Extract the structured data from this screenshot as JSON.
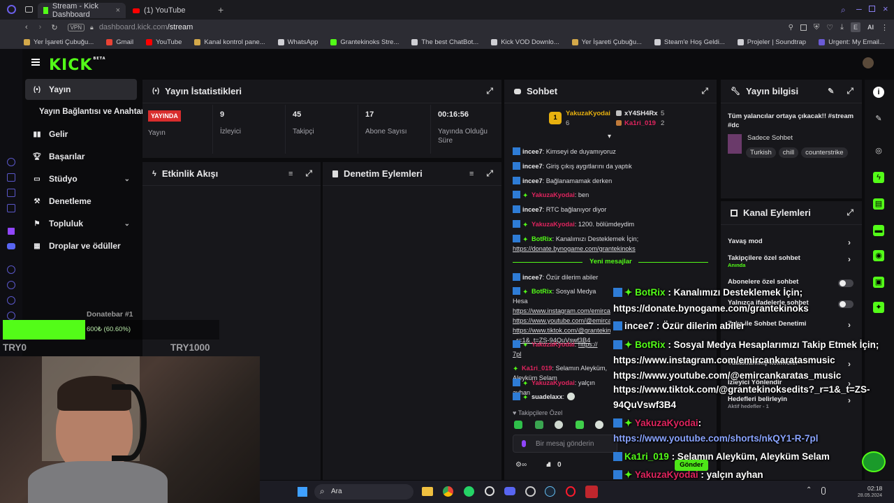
{
  "browser": {
    "tabs": [
      {
        "label": "Stream - Kick Dashboard",
        "active": true
      },
      {
        "label": "(1) YouTube",
        "active": false
      }
    ],
    "url": "dashboard.kick.com/stream",
    "url_host": "dashboard.kick.com",
    "url_path": "/stream",
    "vpn": "VPN",
    "profile_initial": "E",
    "ai_label": "AI",
    "bookmarks": [
      {
        "label": "Yer İşareti Çubuğu...",
        "color": "#d4a94a"
      },
      {
        "label": "Gmail",
        "color": "#ea4335"
      },
      {
        "label": "YouTube",
        "color": "#ff0000"
      },
      {
        "label": "Kanal kontrol pane...",
        "color": "#d4a94a"
      },
      {
        "label": "WhatsApp",
        "color": "#cfcfd4"
      },
      {
        "label": "Grantekinoks Stre...",
        "color": "#53fc18"
      },
      {
        "label": "The best ChatBot...",
        "color": "#cfcfd4"
      },
      {
        "label": "Kick VOD Downlo...",
        "color": "#cfcfd4"
      },
      {
        "label": "Yer İşareti Çubuğu...",
        "color": "#d4a94a"
      },
      {
        "label": "Steam'e Hoş Geldi...",
        "color": "#cfcfd4"
      },
      {
        "label": "Projeler | Soundtrap",
        "color": "#cfcfd4"
      },
      {
        "label": "Urgent: My Email...",
        "color": "#6b5bd6"
      }
    ]
  },
  "kick": {
    "logo": "KICK",
    "logo_badge": "BETA",
    "nav": [
      {
        "label": "Yayın",
        "icon": "broadcast-icon",
        "active": true
      },
      {
        "label": "Yayın Bağlantısı ve Anahtarı",
        "icon": "",
        "active": false
      },
      {
        "label": "Gelir",
        "icon": "chart-icon",
        "active": false
      },
      {
        "label": "Başarılar",
        "icon": "trophy-icon",
        "active": false
      },
      {
        "label": "Stüdyo",
        "icon": "studio-icon",
        "active": false
      },
      {
        "label": "Denetleme",
        "icon": "hammer-icon",
        "active": false
      },
      {
        "label": "Topluluk",
        "icon": "community-icon",
        "active": false
      },
      {
        "label": "Droplar ve ödüller",
        "icon": "gift-icon",
        "active": false
      }
    ]
  },
  "stats_panel": {
    "title": "Yayın İstatistikleri",
    "live_badge": "YAYINDA",
    "items": [
      {
        "value": "",
        "label": "Yayın"
      },
      {
        "value": "9",
        "label": "İzleyici"
      },
      {
        "value": "45",
        "label": "Takipçi"
      },
      {
        "value": "17",
        "label": "Abone Sayısı"
      },
      {
        "value": "00:16:56",
        "label": "Yayında Olduğu Süre"
      }
    ]
  },
  "activity_panel": {
    "title": "Etkinlik Akışı"
  },
  "mod_panel": {
    "title": "Denetim Eylemleri"
  },
  "chat_panel": {
    "title": "Sohbet",
    "leaderboard": [
      {
        "rank": "1",
        "name": "YakuzaKyodai",
        "count": "6"
      },
      {
        "rank": "",
        "name": "xY4SH4Rx",
        "count": "5"
      },
      {
        "rank": "",
        "name": "Ka1ri_019",
        "count": "2"
      }
    ],
    "messages": [
      {
        "user": "incee7",
        "text": ": Kimseyi de duyamıyoruz"
      },
      {
        "user": "incee7",
        "text": ": Giriş çıkış aygıtlarını da yaptık"
      },
      {
        "user": "incee7",
        "text": ": Bağlanamamak derken"
      },
      {
        "user": "YakuzaKyodai",
        "text": ": ben"
      },
      {
        "user": "incee7",
        "text": ": RTC bağlanıyor diyor"
      },
      {
        "user": "YakuzaKyodai",
        "text": ": 1200. bölümdeydim"
      },
      {
        "user": "BotRix",
        "text": ": Kanalımızı Desteklemek İçin;",
        "link": "https://donate.bynogame.com/grantekinoks"
      }
    ],
    "new_messages_label": "Yeni mesajlar",
    "messages_after": [
      {
        "user": "incee7",
        "text": ": Özür dilerim abiler"
      },
      {
        "user": "BotRix",
        "text": ": Sosyal Medya Hesa",
        "links": [
          "https://www.instagram.com/emircankaratasmusic",
          "https://www.youtube.com/@emirca",
          "https://www.tiktok.com/@grantekinoksedits?_r=1&_t=ZS-94QuVswf3B4"
        ]
      },
      {
        "user": "YakuzaKyodai",
        "text": ": ",
        "link": "https://",
        "link_tail": "7pl"
      },
      {
        "user": "Ka1ri_019",
        "text": ": Selamın Aleyküm, Aleyküm Selam"
      },
      {
        "user": "YakuzaKyodai",
        "text": ": yalçın ayhan"
      },
      {
        "user": "suadelaxx",
        "text": ":"
      }
    ],
    "followers_only": "Takipçilere Özel",
    "input_placeholder": "Bir mesaj gönderin",
    "send_label": "Gönder",
    "counter": "0"
  },
  "stream_info": {
    "title": "Yayın bilgisi",
    "stream_title": "Tüm yalancılar ortaya çıkacak!! #stream #dc",
    "category": "Sadece Sohbet",
    "tags": [
      "Turkish",
      "chill",
      "counterstrike"
    ]
  },
  "channel_actions": {
    "title": "Kanal Eylemleri",
    "items": [
      {
        "label": "Yavaş mod",
        "sub": ""
      },
      {
        "label": "Takipçilere özel sohbet",
        "sub": "Anında"
      },
      {
        "label": "Abonelere özel sohbet",
        "sub": ""
      },
      {
        "label": "Yalnızca ifadelerle sohbet",
        "sub": ""
      },
      {
        "label": "Zeka ile Sohbet Denetimi",
        "sub": ""
      },
      {
        "label": "Yasaklanmış kelimeler",
        "sub": ""
      },
      {
        "label": "İzleyici Yönlendir",
        "sub": ""
      },
      {
        "label": "Hedefleri belirleyin",
        "sub": "Aktif hedefler - 1"
      }
    ]
  },
  "donatebar": {
    "title": "Donatebar #1",
    "progress_text": "600₺ (60.60%)",
    "progress": 0.606,
    "min_label": "TRY0",
    "max_label": "TRY1000"
  },
  "overlay_chat": [
    {
      "user": "BotRix",
      "text": " : Kanalımızı Desteklemek İçin;"
    },
    {
      "user": "",
      "text": "https://donate.bynogame.com/grantekinoks"
    },
    {
      "user": "incee7",
      "text": " : Özür dilerim abiler"
    },
    {
      "user": "BotRix",
      "text": " : Sosyal Medya Hesaplarımızı Takip Etmek İçin;"
    },
    {
      "user": "",
      "text": "https://www.instagram.com/emircankaratasmusic"
    },
    {
      "user": "",
      "text": "https://www.youtube.com/@emircankaratas_music"
    },
    {
      "user": "",
      "text": "https://www.tiktok.com/@grantekinoksedits?_r=1&_t=ZS-"
    },
    {
      "user": "",
      "text": "94QuVswf3B4"
    },
    {
      "user": "YakuzaKyodai",
      "text": ":"
    },
    {
      "user": "",
      "text": "https://www.youtube.com/shorts/nkQY1-R-7pl"
    },
    {
      "user": "Ka1ri_019",
      "text": " : Selamın Aleyküm, Aleyküm Selam"
    },
    {
      "user": "YakuzaKyodai",
      "text": " : yalçın ayhan"
    },
    {
      "user": "suadelaxx",
      "text": " :"
    }
  ],
  "taskbar": {
    "search_placeholder": "Ara",
    "time": "02:18",
    "date": "28.05.2024"
  },
  "colors": {
    "accent": "#53fc18",
    "live": "#d92d2d",
    "username_red": "#e0245e"
  }
}
